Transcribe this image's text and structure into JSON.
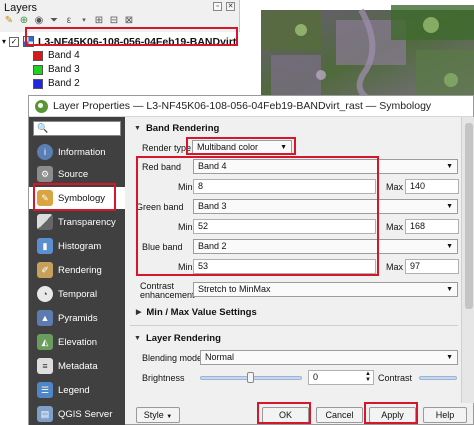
{
  "layers_panel": {
    "title": "Layers",
    "layer_name": "L3-NF45K06-108-056-04Feb19-BANDvirt",
    "bands": [
      {
        "label": "Band 4",
        "color": "#d7191c"
      },
      {
        "label": "Band 3",
        "color": "#1fd11f"
      },
      {
        "label": "Band 2",
        "color": "#1f27e0"
      }
    ]
  },
  "dialog": {
    "title": "Layer Properties — L3-NF45K06-108-056-04Feb19-BANDvirt_rast — Symbology",
    "search_placeholder": "",
    "nav": [
      {
        "label": "Information",
        "icon": "information-icon"
      },
      {
        "label": "Source",
        "icon": "source-icon"
      },
      {
        "label": "Symbology",
        "icon": "symbology-brush-icon",
        "selected": true
      },
      {
        "label": "Transparency",
        "icon": "transparency-icon"
      },
      {
        "label": "Histogram",
        "icon": "histogram-icon"
      },
      {
        "label": "Rendering",
        "icon": "rendering-icon"
      },
      {
        "label": "Temporal",
        "icon": "temporal-clock-icon"
      },
      {
        "label": "Pyramids",
        "icon": "pyramids-icon"
      },
      {
        "label": "Elevation",
        "icon": "elevation-icon"
      },
      {
        "label": "Metadata",
        "icon": "metadata-icon"
      },
      {
        "label": "Legend",
        "icon": "legend-icon"
      },
      {
        "label": "QGIS Server",
        "icon": "qgis-server-icon"
      }
    ],
    "band_rendering": {
      "heading": "Band Rendering",
      "render_type_label": "Render type",
      "render_type_value": "Multiband color",
      "red": {
        "label": "Red band",
        "band": "Band 4",
        "min_label": "Min",
        "min": "8",
        "max_label": "Max",
        "max": "140"
      },
      "green": {
        "label": "Green band",
        "band": "Band 3",
        "min_label": "Min",
        "min": "52",
        "max_label": "Max",
        "max": "168"
      },
      "blue": {
        "label": "Blue band",
        "band": "Band 2",
        "min_label": "Min",
        "min": "53",
        "max_label": "Max",
        "max": "97"
      },
      "contrast_label_1": "Contrast",
      "contrast_label_2": "enhancement",
      "contrast_value": "Stretch to MinMax",
      "minmax_heading": "Min / Max Value Settings"
    },
    "layer_rendering": {
      "heading": "Layer Rendering",
      "blending_label": "Blending mode",
      "blending_value": "Normal",
      "brightness_label": "Brightness",
      "brightness_value": "0",
      "brightness_level": 0.5,
      "contrast_label": "Contrast"
    },
    "buttons": {
      "style": "Style",
      "ok": "OK",
      "cancel": "Cancel",
      "apply": "Apply",
      "help": "Help"
    },
    "highlight_color": "#d4172a"
  }
}
